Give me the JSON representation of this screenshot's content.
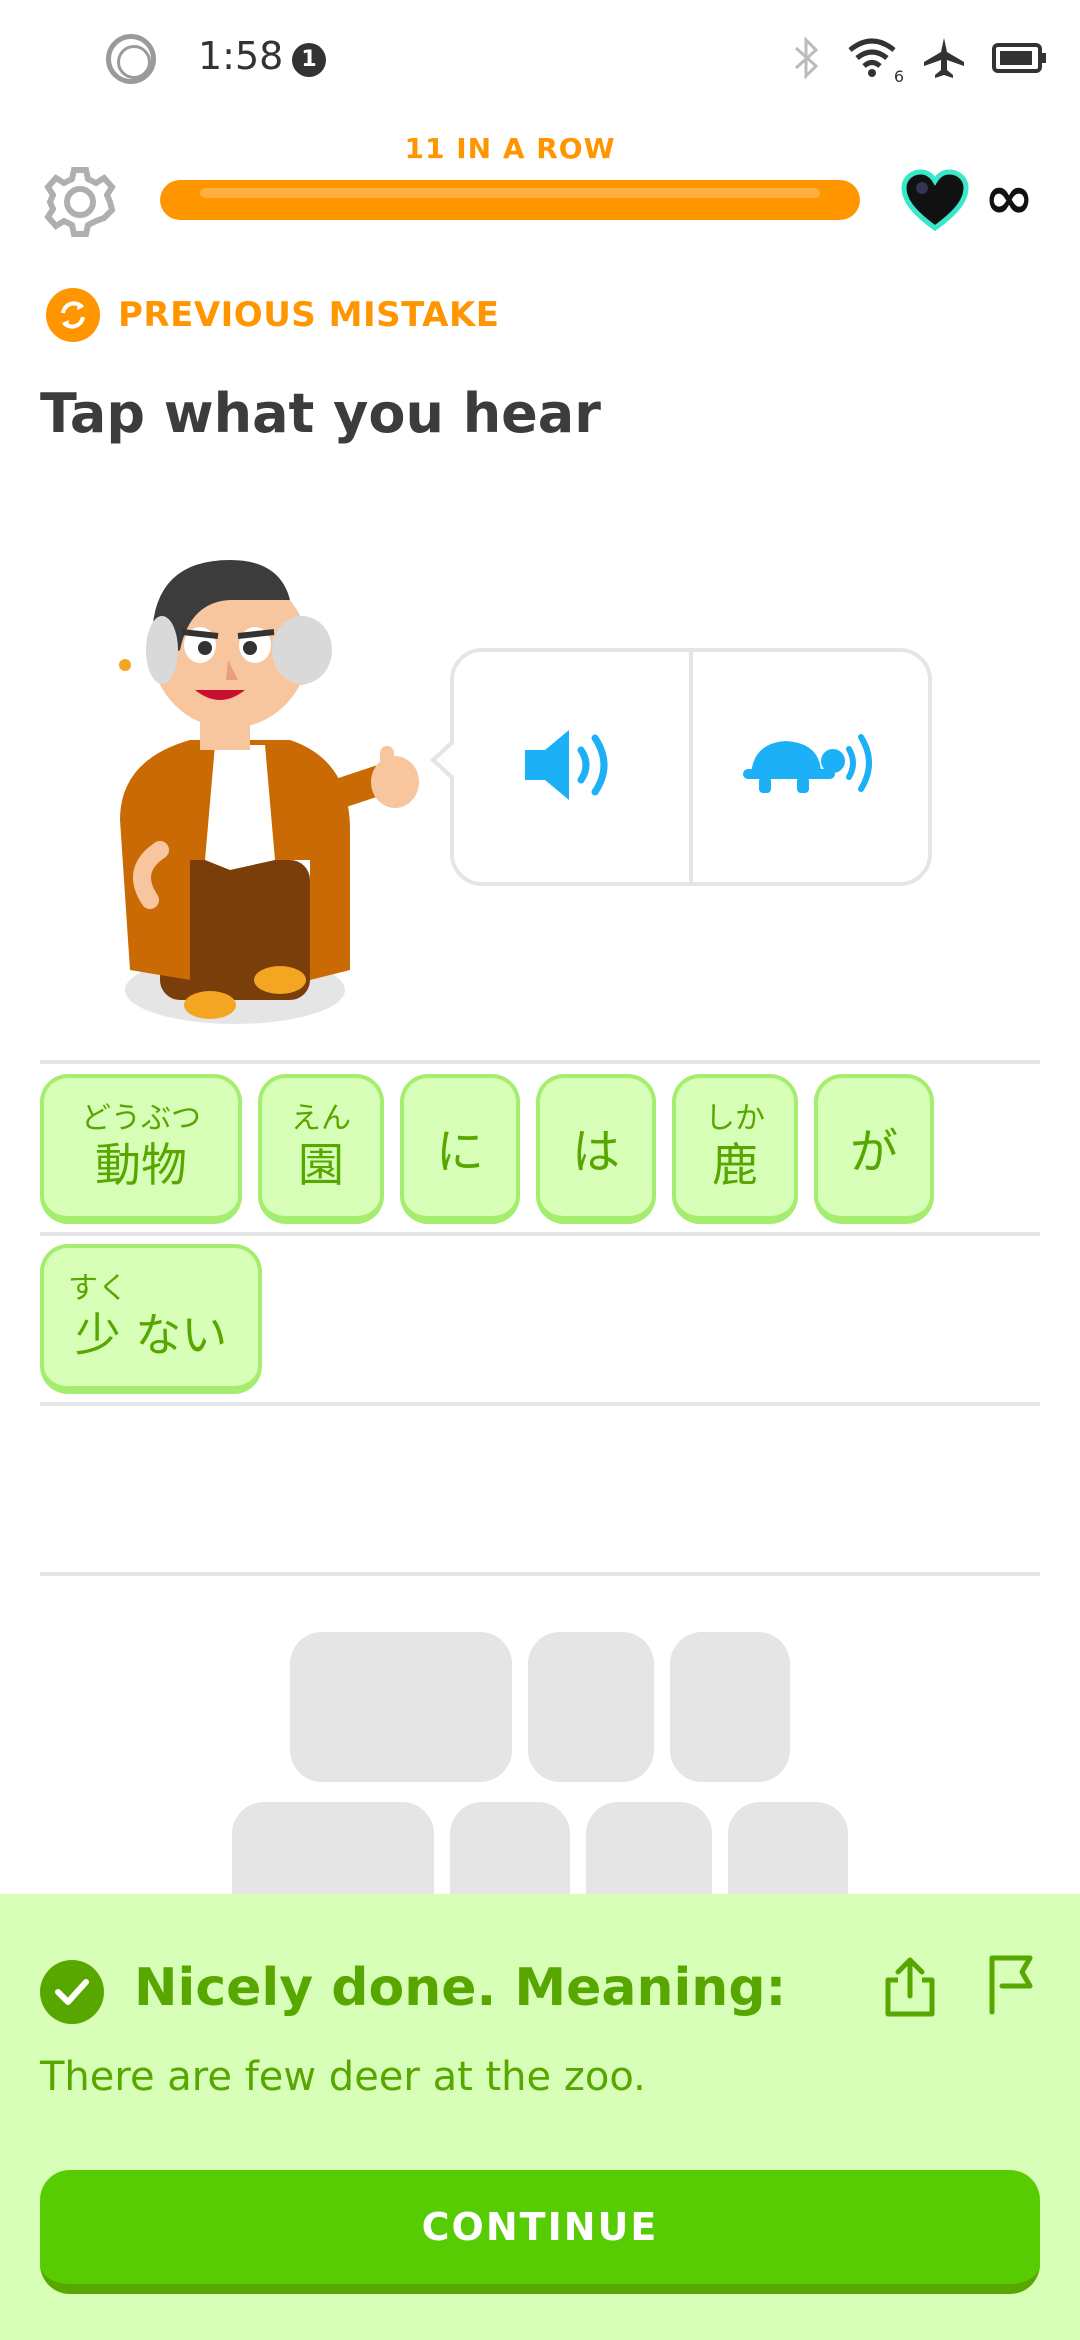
{
  "status_bar": {
    "time": "1:58",
    "notification_count": "1",
    "wifi_label": "6"
  },
  "header": {
    "streak_label": "11 IN A ROW",
    "progress_fraction": 1.0,
    "hearts": "∞"
  },
  "exercise": {
    "tag": "PREVIOUS MISTAKE",
    "instruction": "Tap what you hear",
    "audio_buttons": [
      "speaker-icon",
      "turtle-slow-icon"
    ]
  },
  "answer_tiles": [
    {
      "ruby": "どうぶつ",
      "text": "動物"
    },
    {
      "ruby": "えん",
      "text": "園"
    },
    {
      "ruby": "",
      "text": "に"
    },
    {
      "ruby": "",
      "text": "は"
    },
    {
      "ruby": "しか",
      "text": "鹿"
    },
    {
      "ruby": "",
      "text": "が"
    },
    {
      "ruby": "すく",
      "text": "少 ない"
    }
  ],
  "feedback": {
    "title": "Nicely done. Meaning:",
    "meaning": "There are few deer at the zoo.",
    "continue_label": "CONTINUE"
  },
  "colors": {
    "orange": "#ff9600",
    "green_dark": "#58a700",
    "green_button": "#58cc02",
    "green_light": "#d7ffb8",
    "blue": "#1cb0f6",
    "gray": "#e5e5e5"
  }
}
